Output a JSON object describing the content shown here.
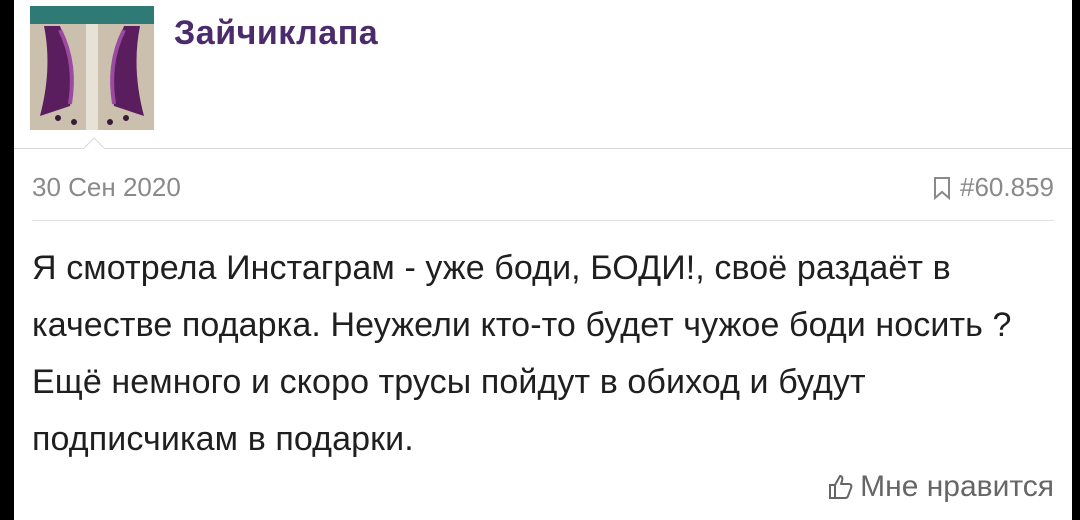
{
  "post": {
    "author": "Зайчиклапа",
    "date": "30 Сен 2020",
    "post_number": "#60.859",
    "text": "Я смотрела Инстаграм - уже боди, БОДИ!, своё раздаёт в качестве подарка. Неужели кто-то будет чужое боди носить ? Ещё немного и скоро трусы пойдут в обиход и будут подписчикам в подарки.",
    "like_label": "Мне нравится"
  },
  "icons": {
    "bookmark": "bookmark-icon",
    "like": "thumbs-up-icon"
  },
  "colors": {
    "author": "#4b2b6b",
    "meta": "#8a8a8a",
    "text": "#1f1f1f"
  }
}
